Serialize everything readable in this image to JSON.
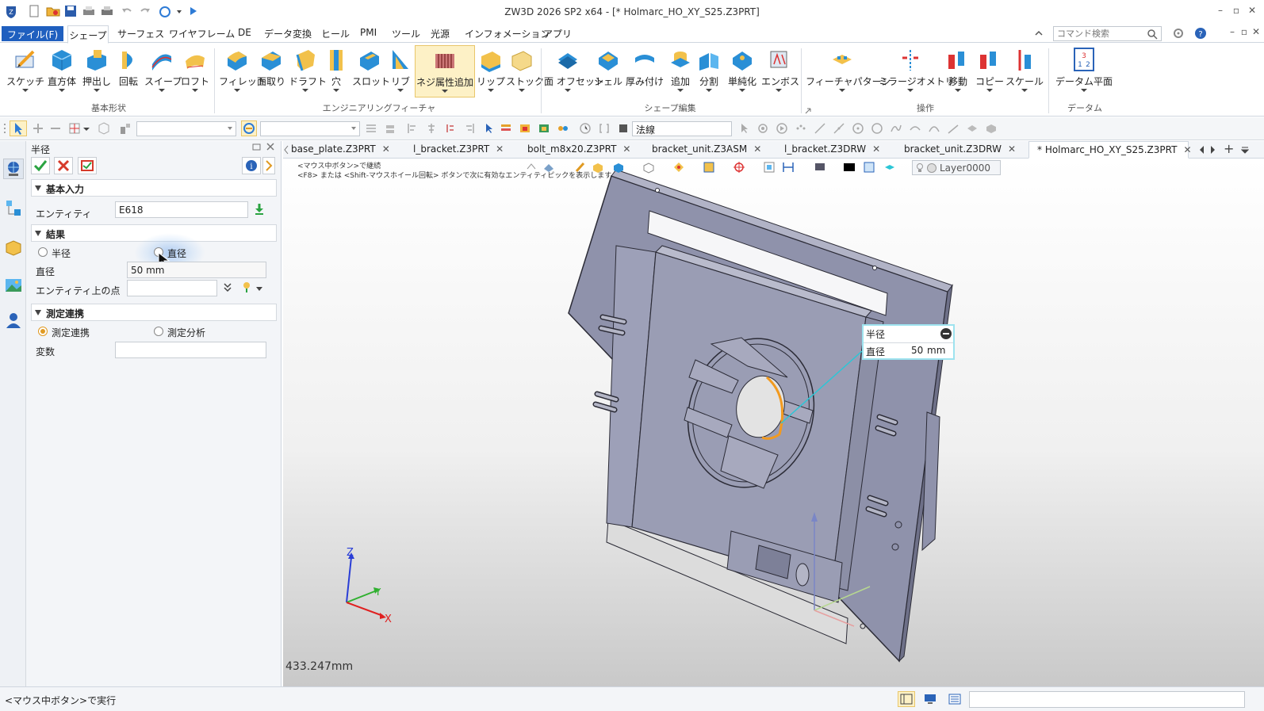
{
  "window": {
    "title": "ZW3D 2026 SP2 x64  - [* Holmarc_HO_XY_S25.Z3PRT]"
  },
  "menu": {
    "file": "ファイル(F)",
    "tabs": [
      "シェープ",
      "サーフェス",
      "ワイヤフレーム",
      "DE",
      "データ変換",
      "ヒール",
      "PMI",
      "ツール",
      "光源",
      "インフォメーション",
      "アプリ"
    ],
    "search_placeholder": "コマンド検索"
  },
  "ribbon": {
    "groups": [
      {
        "label": "基本形状",
        "buttons": [
          "スケッチ",
          "直方体",
          "押出し",
          "回転",
          "スイープ",
          "ロフト"
        ]
      },
      {
        "label": "エンジニアリングフィーチャ",
        "buttons": [
          "フィレット",
          "面取り",
          "ドラフト",
          "穴",
          "スロット",
          "リブ",
          "ネジ属性追加",
          "リップ",
          "ストック"
        ]
      },
      {
        "label": "シェープ編集",
        "buttons": [
          "面 オフセット",
          "シェル",
          "厚み付け",
          "追加",
          "分割",
          "単純化",
          "エンボス"
        ]
      },
      {
        "label": "操作",
        "buttons": [
          "フィーチャパターン",
          "ミラージオメトリ",
          "移動",
          "コピー",
          "スケール"
        ]
      },
      {
        "label": "データム",
        "buttons": [
          "データム平面"
        ]
      }
    ]
  },
  "toolbar": {
    "view_mode": "法線",
    "layer": "Layer0000"
  },
  "panel": {
    "title": "半径",
    "sections": {
      "basic": {
        "title": "基本入力",
        "entity_label": "エンティティ",
        "entity_value": "E618"
      },
      "result": {
        "title": "結果",
        "radius_label": "半径",
        "diameter_label": "直径",
        "diameter_field_label": "直径",
        "diameter_value": "50 mm",
        "point_label": "エンティティ上の点"
      },
      "measure": {
        "title": "測定連携",
        "link_label": "測定連携",
        "analysis_label": "測定分析",
        "variable_label": "変数"
      }
    }
  },
  "tabs": [
    {
      "label": "base_plate.Z3PRT"
    },
    {
      "label": "l_bracket.Z3PRT"
    },
    {
      "label": "bolt_m8x20.Z3PRT"
    },
    {
      "label": "bracket_unit.Z3ASM"
    },
    {
      "label": "l_bracket.Z3DRW"
    },
    {
      "label": "bracket_unit.Z3DRW"
    },
    {
      "label": "* Holmarc_HO_XY_S25.Z3PRT"
    }
  ],
  "viewport": {
    "hint_line1": "<マウス中ボタン>で継続",
    "hint_line2": "<F8> または <Shift-マウスホイール回転> ボタンで次に有効なエンティティピックを表示します。",
    "scale_text": "433.247mm",
    "axes": {
      "x": "X",
      "y": "Y",
      "z": "Z"
    },
    "callout": {
      "row1_label": "半径",
      "row2_label": "直径",
      "row2_value": "50",
      "row2_unit": "mm"
    }
  },
  "status": {
    "text": "<マウス中ボタン>で実行"
  },
  "colors": {
    "accent": "#1f5fbf",
    "highlight_edge": "#f29a1f",
    "callout_border": "#9ee3ef",
    "leader": "#2bc6d6",
    "part_body": "#9a9db4"
  }
}
